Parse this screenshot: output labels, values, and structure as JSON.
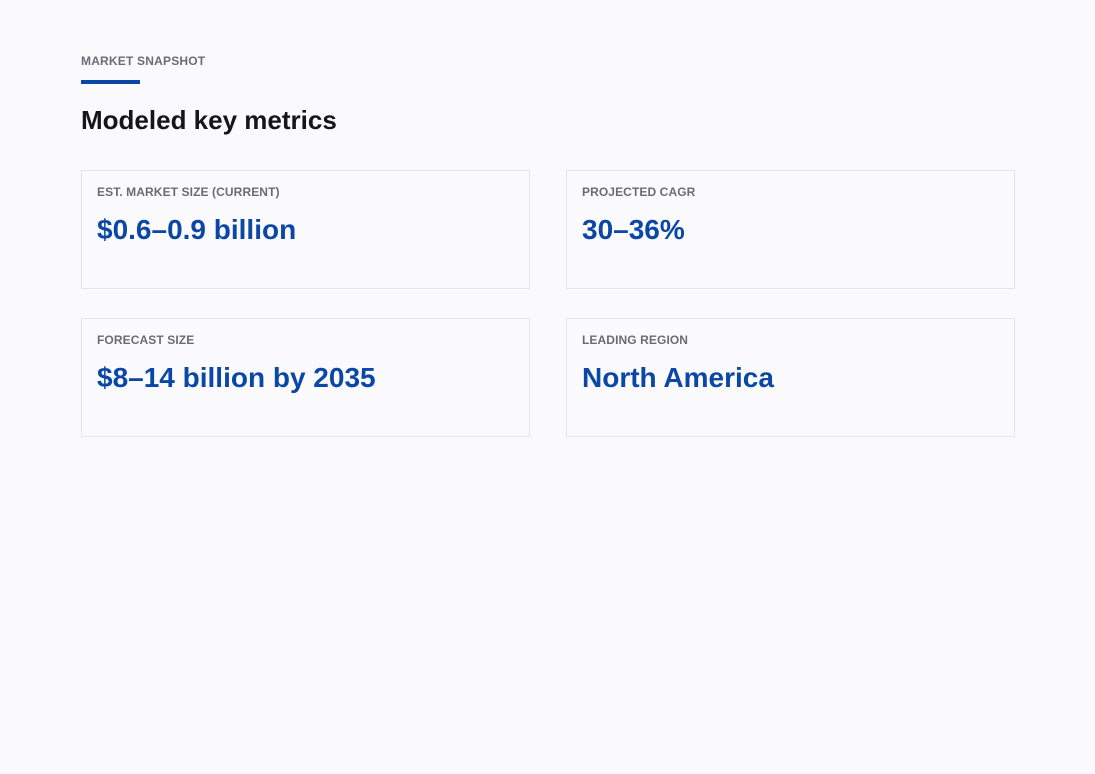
{
  "header": {
    "eyebrow": "MARKET SNAPSHOT",
    "title": "Modeled key metrics"
  },
  "metrics": [
    {
      "label": "EST. MARKET SIZE (CURRENT)",
      "value": "$0.6–0.9 billion"
    },
    {
      "label": "PROJECTED CAGR",
      "value": "30–36%"
    },
    {
      "label": "FORECAST SIZE",
      "value": "$8–14 billion by 2035"
    },
    {
      "label": "LEADING REGION",
      "value": "North America"
    }
  ],
  "colors": {
    "accent": "#0b47a6",
    "background": "#fafafc",
    "heading": "#16161a",
    "muted": "#6b6b76",
    "card_border": "#e4e4e9"
  }
}
